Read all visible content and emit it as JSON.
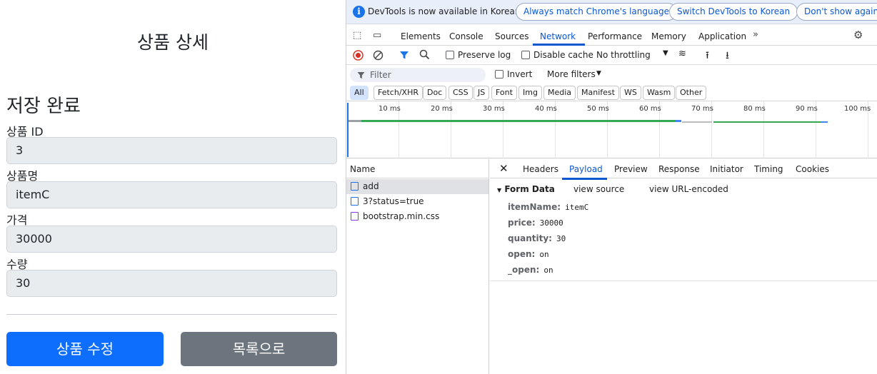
{
  "page": {
    "title": "상품 상세",
    "saved_message": "저장 완료",
    "fields": [
      {
        "label": "상품 ID",
        "value": "3"
      },
      {
        "label": "상품명",
        "value": "itemC"
      },
      {
        "label": "가격",
        "value": "30000"
      },
      {
        "label": "수량",
        "value": "30"
      }
    ],
    "edit_button": "상품 수정",
    "list_button": "목록으로",
    "colors": {
      "primary": "#0d6efd",
      "secondary": "#6c757d",
      "field_bg": "#e9ecef"
    }
  },
  "devtools": {
    "infobar": {
      "message": "DevTools is now available in Korean!",
      "btn_match": "Always match Chrome's language",
      "btn_switch": "Switch DevTools to Korean",
      "btn_dismiss": "Don't show again"
    },
    "tabs": [
      "Elements",
      "Console",
      "Sources",
      "Network",
      "Performance",
      "Memory",
      "Application"
    ],
    "active_tab": "Network",
    "toolbar": {
      "preserve_log": "Preserve log",
      "disable_cache": "Disable cache",
      "throttling": "No throttling"
    },
    "filter": {
      "placeholder": "Filter",
      "invert": "Invert",
      "more_filters": "More filters"
    },
    "type_filters": [
      "All",
      "Fetch/XHR",
      "Doc",
      "CSS",
      "JS",
      "Font",
      "Img",
      "Media",
      "Manifest",
      "WS",
      "Wasm",
      "Other"
    ],
    "timeline_ticks": [
      "10 ms",
      "20 ms",
      "30 ms",
      "40 ms",
      "50 ms",
      "60 ms",
      "70 ms",
      "80 ms",
      "90 ms",
      "100 ms"
    ],
    "requests_header": "Name",
    "requests": [
      {
        "name": "add",
        "type": "doc",
        "selected": true
      },
      {
        "name": "3?status=true",
        "type": "doc",
        "selected": false
      },
      {
        "name": "bootstrap.min.css",
        "type": "css",
        "selected": false
      }
    ],
    "detail_tabs": [
      "Headers",
      "Payload",
      "Preview",
      "Response",
      "Initiator",
      "Timing",
      "Cookies"
    ],
    "active_detail_tab": "Payload",
    "payload": {
      "section": "Form Data",
      "view_source": "view source",
      "view_url_encoded": "view URL-encoded",
      "entries": [
        {
          "key": "itemName:",
          "value": "itemC"
        },
        {
          "key": "price:",
          "value": "30000"
        },
        {
          "key": "quantity:",
          "value": "30"
        },
        {
          "key": "open:",
          "value": "on"
        },
        {
          "key": "_open:",
          "value": "on"
        }
      ]
    }
  }
}
